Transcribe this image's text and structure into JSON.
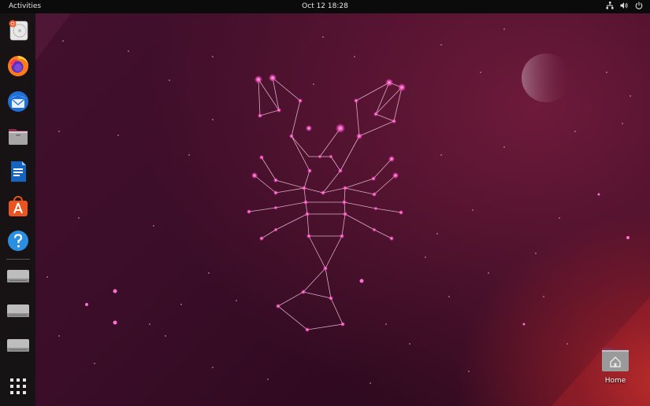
{
  "topbar": {
    "activities_label": "Activities",
    "clock": "Oct 12  18:28",
    "tray": [
      "network-icon",
      "volume-icon",
      "power-icon"
    ]
  },
  "dock": {
    "items": [
      {
        "name": "installer",
        "icon": "disk-installer-icon"
      },
      {
        "name": "firefox",
        "icon": "firefox-icon"
      },
      {
        "name": "thunderbird",
        "icon": "thunderbird-icon"
      },
      {
        "name": "files",
        "icon": "files-icon"
      },
      {
        "name": "writer",
        "icon": "libreoffice-writer-icon"
      },
      {
        "name": "software",
        "icon": "app-center-icon"
      },
      {
        "name": "help",
        "icon": "help-icon"
      },
      {
        "name": "drive-1",
        "icon": "drive-icon"
      },
      {
        "name": "drive-2",
        "icon": "drive-icon"
      },
      {
        "name": "drive-3",
        "icon": "drive-icon"
      }
    ],
    "show_apps_icon": "app-grid-icon"
  },
  "desktop": {
    "home_label": "Home",
    "home_icon": "home-folder-icon"
  },
  "colors": {
    "topbar": "#0b0b0b",
    "dock": "#141414",
    "accent": "#e95420",
    "star": "#ff5fc8"
  }
}
